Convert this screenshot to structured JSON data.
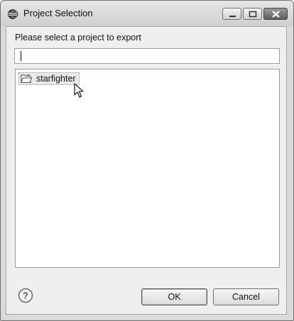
{
  "window": {
    "title": "Project Selection",
    "controls": {
      "minimize": "minimize-icon",
      "maximize": "maximize-icon",
      "close": "close-icon"
    }
  },
  "content": {
    "prompt": "Please select a project to export",
    "filter": {
      "value": "",
      "placeholder": ""
    },
    "projects": [
      {
        "label": "starfighter",
        "icon": "project-folder-icon",
        "selected": true
      }
    ]
  },
  "footer": {
    "help_icon": "help-icon",
    "ok_label": "OK",
    "cancel_label": "Cancel"
  }
}
